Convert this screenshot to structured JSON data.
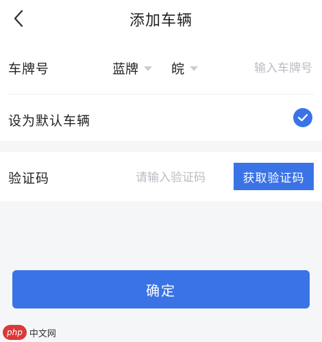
{
  "header": {
    "title": "添加车辆"
  },
  "plate_row": {
    "label": "车牌号",
    "color_value": "蓝牌",
    "province_value": "皖",
    "input_placeholder": "输入车牌号"
  },
  "default_row": {
    "label": "设为默认车辆",
    "checked": true
  },
  "code_row": {
    "label": "验证码",
    "input_placeholder": "请输入验证码",
    "button_label": "获取验证码"
  },
  "footer": {
    "confirm_label": "确定"
  },
  "watermark": {
    "logo": "php",
    "text": "中文网"
  },
  "colors": {
    "accent": "#3a73e6",
    "background": "#f5f6f8",
    "card": "#ffffff",
    "placeholder": "#b9bcc3"
  },
  "icons": {
    "back": "chevron-left-icon",
    "dropdown": "caret-down-icon",
    "check": "check-circle-icon"
  }
}
